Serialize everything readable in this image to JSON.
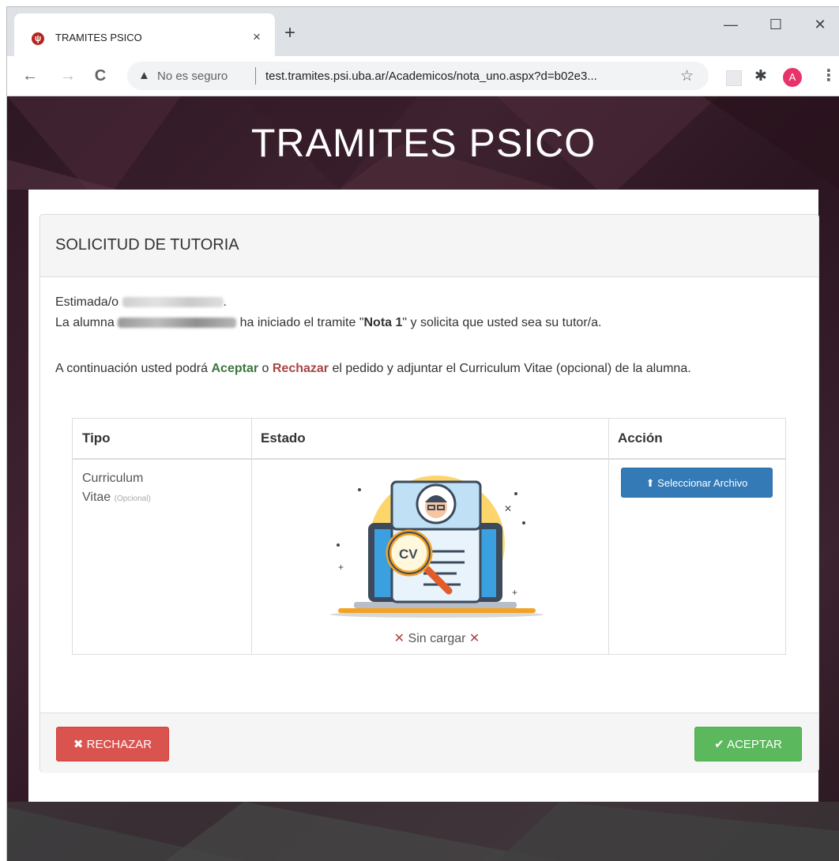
{
  "browser": {
    "tab_title": "TRAMITES PSICO",
    "tab_close": "×",
    "new_tab": "+",
    "window_minimize": "—",
    "window_maximize": "☐",
    "window_close": "✕",
    "not_secure": "No es seguro",
    "url": "test.tramites.psi.uba.ar/Academicos/nota_uno.aspx?d=b02e3...",
    "avatar_initial": "A",
    "favicon_glyph": "ψ",
    "nav_back": "←",
    "nav_forward": "→",
    "nav_reload": "C",
    "warn_glyph": "▲",
    "star_glyph": "☆",
    "puzzle_glyph": "✱",
    "kebab_glyph": "⋮"
  },
  "header": {
    "title": "TRAMITES PSICO"
  },
  "panel": {
    "title": "SOLICITUD DE TUTORIA",
    "greeting_prefix": "Estimada/o",
    "greeting_suffix": ".",
    "line2_prefix": "La alumna",
    "line2_middle": "ha iniciado el tramite \"",
    "tramite_name": "Nota 1",
    "line2_suffix": "\" y solicita que usted sea su tutor/a.",
    "instructions_prefix": "A continuación usted podrá",
    "accept_word": "Aceptar",
    "instructions_or": "o",
    "reject_word": "Rechazar",
    "instructions_suffix": "el pedido y adjuntar el Curriculum Vitae (opcional) de la alumna."
  },
  "table": {
    "headers": [
      "Tipo",
      "Estado",
      "Acción"
    ],
    "row": {
      "tipo_line1": "Curriculum",
      "tipo_line2": "Vitae",
      "tipo_note": "(Opcional)",
      "estado": "Sin cargar",
      "estado_x": "✕",
      "accion_button": "Seleccionar Archivo",
      "illustration_label": "CV"
    }
  },
  "footer": {
    "reject_label": "RECHAZAR",
    "accept_label": "ACEPTAR",
    "reject_icon": "✖",
    "accept_icon": "✔",
    "upload_icon": "⬆"
  },
  "colors": {
    "primary": "#337ab7",
    "danger": "#d9534f",
    "success": "#5cb85c",
    "accept_text": "#3c763d",
    "reject_text": "#a94442"
  }
}
